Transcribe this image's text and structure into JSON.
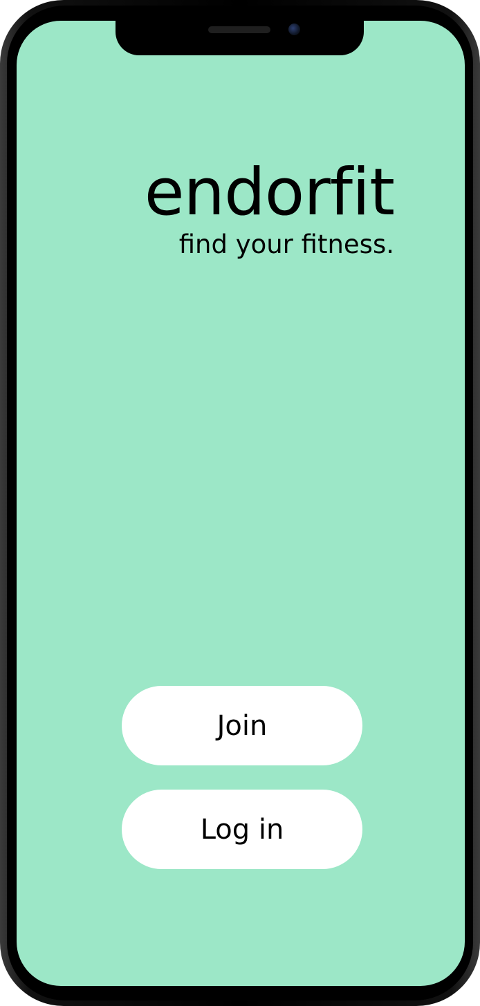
{
  "app": {
    "logo_text": "endorfit",
    "tagline": "find your fitness."
  },
  "actions": {
    "join_label": "Join",
    "login_label": "Log in"
  },
  "colors": {
    "screen_background": "#9ce7c7",
    "button_background": "#ffffff",
    "text": "#000000"
  }
}
